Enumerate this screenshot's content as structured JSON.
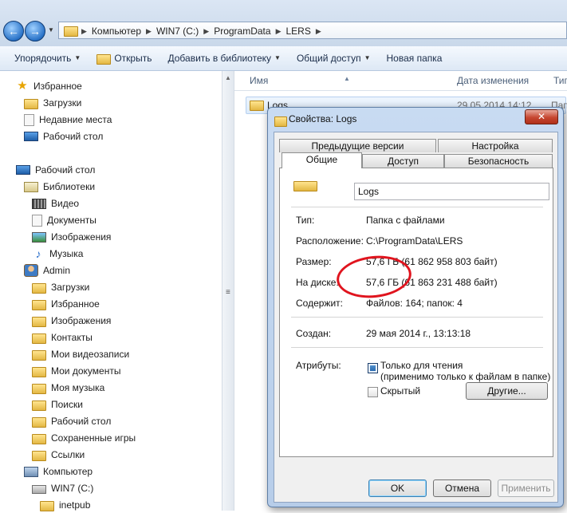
{
  "address_bar": {
    "crumbs": [
      "Компьютер",
      "WIN7 (C:)",
      "ProgramData",
      "LERS"
    ]
  },
  "toolbar": {
    "organize": "Упорядочить",
    "open": "Открыть",
    "add_library": "Добавить в библиотеку",
    "share": "Общий доступ",
    "new_folder": "Новая папка"
  },
  "nav": {
    "favorites": "Избранное",
    "downloads": "Загрузки",
    "recent": "Недавние места",
    "desktop": "Рабочий стол",
    "desktop_root": "Рабочий стол",
    "libraries": "Библиотеки",
    "video": "Видео",
    "documents": "Документы",
    "images": "Изображения",
    "music": "Музыка",
    "admin": "Admin",
    "admin_downloads": "Загрузки",
    "admin_favorites": "Избранное",
    "admin_images": "Изображения",
    "contacts": "Контакты",
    "my_videos": "Мои видеозаписи",
    "my_documents": "Мои документы",
    "my_music": "Моя музыка",
    "searches": "Поиски",
    "admin_desktop": "Рабочий стол",
    "saved_games": "Сохраненные игры",
    "links": "Ссылки",
    "computer": "Компьютер",
    "drive_c": "WIN7 (C:)",
    "inetpub": "inetpub"
  },
  "columns": {
    "name": "Имя",
    "date": "Дата изменения",
    "type": "Тип"
  },
  "file": {
    "name": "Logs",
    "date": "29.05.2014 14:12",
    "type": "Пап"
  },
  "dialog": {
    "title": "Свойства: Logs",
    "close": "✕",
    "tabs": {
      "prev_versions": "Предыдущие версии",
      "settings": "Настройка",
      "general": "Общие",
      "access": "Доступ",
      "security": "Безопасность"
    },
    "folder_name": "Logs",
    "type_label": "Тип:",
    "type_value": "Папка с файлами",
    "location_label": "Расположение:",
    "location_value": "C:\\ProgramData\\LERS",
    "size_label": "Размер:",
    "size_value": "57,6 ГБ (61 862 958 803 байт)",
    "disk_label": "На диске:",
    "disk_value": "57,6 ГБ (61 863 231 488 байт)",
    "contains_label": "Содержит:",
    "contains_value": "Файлов: 164; папок: 4",
    "created_label": "Создан:",
    "created_value": "29 мая 2014 г., 13:13:18",
    "attributes_label": "Атрибуты:",
    "readonly_label": "Только для чтения",
    "readonly_note": "(применимо только к файлам в папке)",
    "hidden_label": "Скрытый",
    "other_button": "Другие...",
    "ok": "OK",
    "cancel": "Отмена",
    "apply": "Применить"
  },
  "colors": {
    "annotation_circle": "#e0141e",
    "close_button": "#c64630"
  }
}
